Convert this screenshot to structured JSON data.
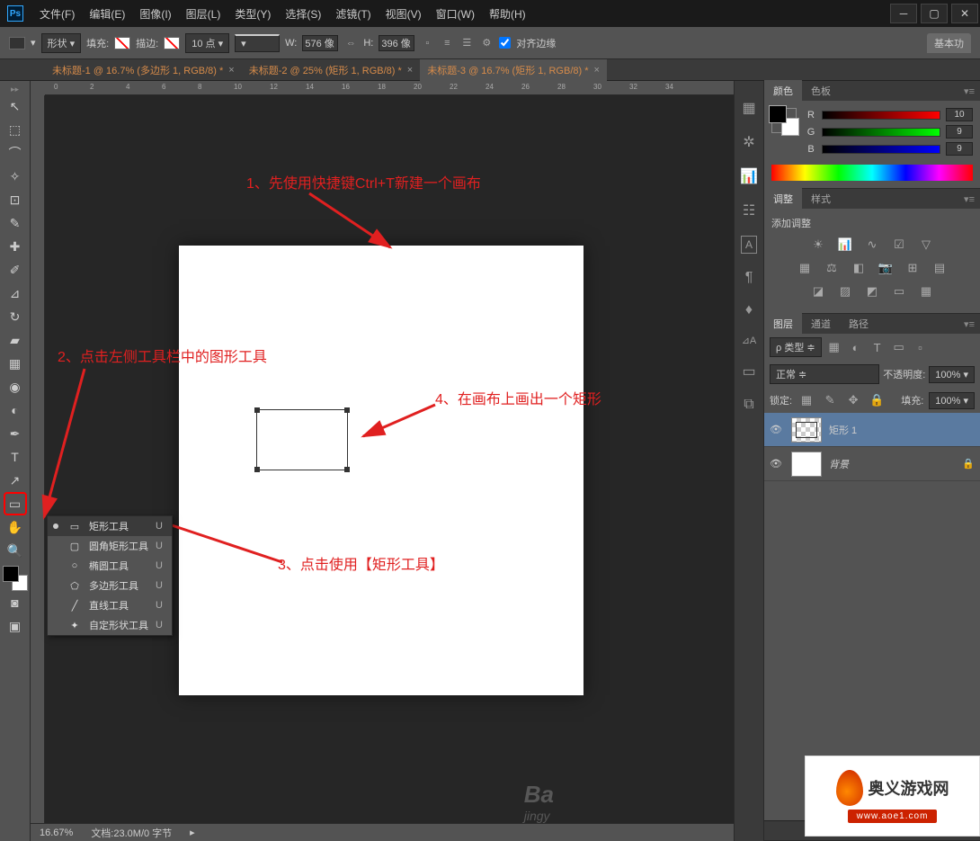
{
  "app": {
    "icon": "Ps"
  },
  "menu": [
    "文件(F)",
    "编辑(E)",
    "图像(I)",
    "图层(L)",
    "类型(Y)",
    "选择(S)",
    "滤镜(T)",
    "视图(V)",
    "窗口(W)",
    "帮助(H)"
  ],
  "options": {
    "shape_mode": "形状",
    "fill_label": "填充:",
    "stroke_label": "描边:",
    "stroke_width": "10 点",
    "w_label": "W:",
    "w_value": "576 像",
    "h_label": "H:",
    "h_value": "396 像",
    "align_label": "对齐边缘",
    "right_button": "基本功"
  },
  "tabs": [
    {
      "label": "未标题-1 @ 16.7% (多边形 1, RGB/8) *",
      "active": false
    },
    {
      "label": "未标题-2 @ 25% (矩形 1, RGB/8) *",
      "active": false
    },
    {
      "label": "未标题-3 @ 16.7% (矩形 1, RGB/8) *",
      "active": true
    }
  ],
  "ruler_h": [
    "0",
    "2",
    "4",
    "6",
    "8",
    "10",
    "12",
    "14",
    "16",
    "18",
    "20",
    "22",
    "24",
    "26",
    "28",
    "30",
    "32",
    "34"
  ],
  "flyout": [
    {
      "icon": "▭",
      "label": "矩形工具",
      "key": "U",
      "active": true
    },
    {
      "icon": "▢",
      "label": "圆角矩形工具",
      "key": "U",
      "active": false
    },
    {
      "icon": "○",
      "label": "椭圆工具",
      "key": "U",
      "active": false
    },
    {
      "icon": "⬠",
      "label": "多边形工具",
      "key": "U",
      "active": false
    },
    {
      "icon": "╱",
      "label": "直线工具",
      "key": "U",
      "active": false
    },
    {
      "icon": "✦",
      "label": "自定形状工具",
      "key": "U",
      "active": false
    }
  ],
  "annotations": {
    "a1": "1、先使用快捷键Ctrl+T新建一个画布",
    "a2": "2、点击左侧工具栏中的图形工具",
    "a3": "3、点击使用【矩形工具】",
    "a4": "4、在画布上画出一个矩形"
  },
  "status": {
    "zoom": "16.67%",
    "doc": "文档:23.0M/0 字节"
  },
  "color_panel": {
    "tab1": "颜色",
    "tab2": "色板",
    "r_label": "R",
    "r_val": "10",
    "g_label": "G",
    "g_val": "9",
    "b_label": "B",
    "b_val": "9"
  },
  "adj_panel": {
    "tab1": "调整",
    "tab2": "样式",
    "title": "添加调整"
  },
  "layers_panel": {
    "tab1": "图层",
    "tab2": "通道",
    "tab3": "路径",
    "kind": "ρ 类型",
    "blend": "正常",
    "opacity_label": "不透明度:",
    "opacity_val": "100%",
    "lock_label": "锁定:",
    "fill_label": "填充:",
    "fill_val": "100%",
    "layer1": "矩形 1",
    "layer2": "背景"
  },
  "watermark": {
    "text": "奥义游戏网",
    "url": "www.aoe1.com",
    "baidu": "Ba",
    "jingyan": "jingy"
  }
}
